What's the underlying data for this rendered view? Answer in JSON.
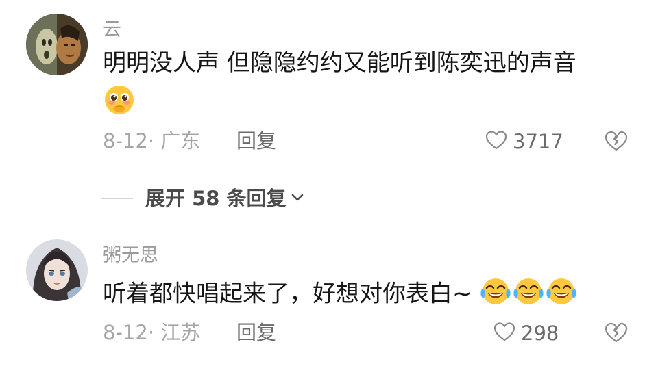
{
  "comments": [
    {
      "username": "云",
      "text": "明明没人声 但隐隐约约又能听到陈奕迅的声音",
      "emoji": [
        "shy-face-emoji"
      ],
      "date": "8-12",
      "location": "· 广东",
      "reply_label": "回复",
      "like_count": "3717"
    },
    {
      "username": "粥无思",
      "text": "听着都快唱起来了，好想对你表白~",
      "emoji": [
        "crying-laughing-emoji",
        "crying-laughing-emoji",
        "crying-laughing-emoji"
      ],
      "date": "8-12",
      "location": "· 江苏",
      "reply_label": "回复",
      "like_count": "298"
    }
  ],
  "expand_replies": {
    "label": "展开 58 条回复"
  },
  "icons": {
    "like": "heart-outline-icon",
    "dislike": "broken-heart-icon",
    "expand": "chevron-down-icon"
  },
  "colors": {
    "text_primary": "#161616",
    "text_secondary": "#9a9a9a",
    "emoji_yellow": "#ffc83d"
  }
}
